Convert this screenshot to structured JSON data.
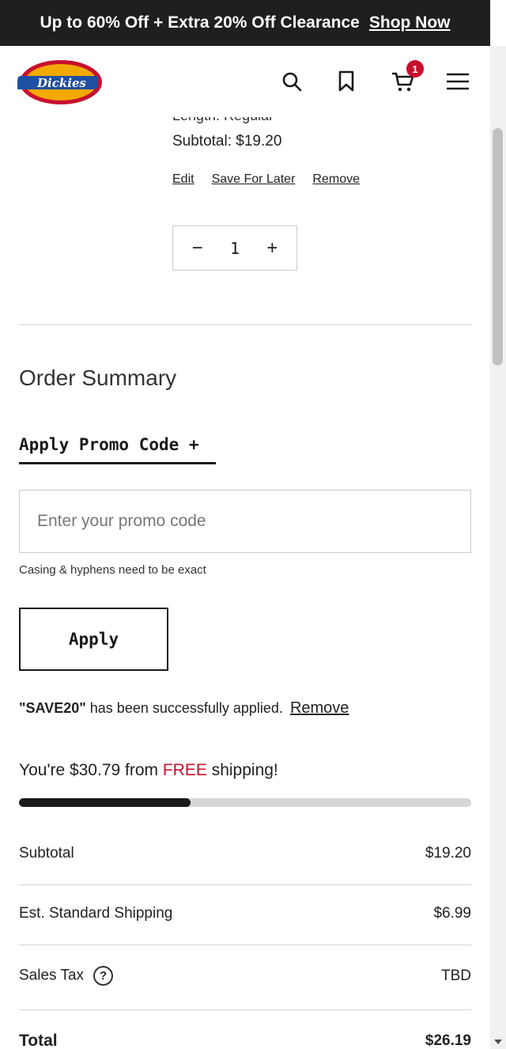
{
  "banner": {
    "text": "Up to 60% Off + Extra 20% Off Clearance",
    "link": "Shop Now"
  },
  "header": {
    "logo_text": "Dickies",
    "cart_count": "1"
  },
  "cart_item": {
    "cut_text": "Length: Regular",
    "subtotal": "Subtotal: $19.20",
    "edit": "Edit",
    "save_for_later": "Save For Later",
    "remove": "Remove",
    "quantity": "1",
    "minus": "−",
    "plus": "+"
  },
  "summary": {
    "title": "Order Summary",
    "promo_tab": "Apply Promo Code +",
    "promo_placeholder": "Enter your promo code",
    "hint": "Casing & hyphens need to be exact",
    "apply": "Apply",
    "applied_code": "\"SAVE20\"",
    "applied_text": " has been successfully applied.",
    "applied_remove": "Remove",
    "ship_prefix": "You're $30.79 from ",
    "ship_free": "FREE",
    "ship_suffix": " shipping!",
    "ship_progress": 0.38,
    "rows": [
      {
        "label": "Subtotal",
        "value": "$19.20"
      },
      {
        "label": "Est. Standard Shipping",
        "value": "$6.99"
      },
      {
        "label": "Sales Tax",
        "value": "TBD"
      },
      {
        "label": "Total",
        "value": "$26.19"
      }
    ],
    "help_icon_glyph": "?"
  },
  "colors": {
    "accent_red": "#c8102e",
    "banner_bg": "#1f1f1f"
  }
}
